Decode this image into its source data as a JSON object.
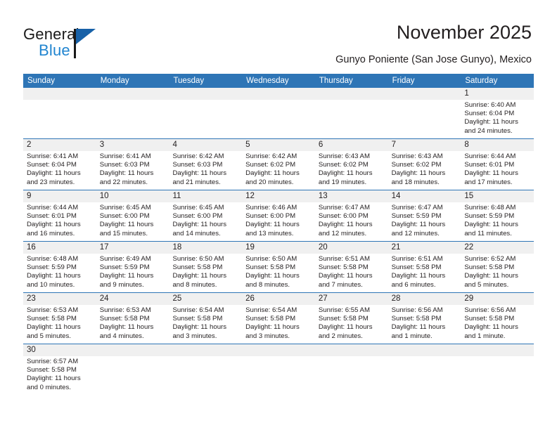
{
  "brand": {
    "name_top": "General",
    "name_bottom": "Blue",
    "accent_color": "#2185d0",
    "triangle_color": "#1761a8"
  },
  "header": {
    "title": "November 2025",
    "subtitle": "Gunyo Poniente (San Jose Gunyo), Mexico",
    "header_bg": "#2e75b6",
    "daynum_band": "#f0f0f0"
  },
  "weekdays": [
    "Sunday",
    "Monday",
    "Tuesday",
    "Wednesday",
    "Thursday",
    "Friday",
    "Saturday"
  ],
  "labels": {
    "sunrise": "Sunrise:",
    "sunset": "Sunset:",
    "daylight": "Daylight:"
  },
  "weeks": [
    [
      {
        "day": "",
        "empty": true
      },
      {
        "day": "",
        "empty": true
      },
      {
        "day": "",
        "empty": true
      },
      {
        "day": "",
        "empty": true
      },
      {
        "day": "",
        "empty": true
      },
      {
        "day": "",
        "empty": true
      },
      {
        "day": "1",
        "sunrise": "Sunrise: 6:40 AM",
        "sunset": "Sunset: 6:04 PM",
        "daylight1": "Daylight: 11 hours",
        "daylight2": "and 24 minutes."
      }
    ],
    [
      {
        "day": "2",
        "sunrise": "Sunrise: 6:41 AM",
        "sunset": "Sunset: 6:04 PM",
        "daylight1": "Daylight: 11 hours",
        "daylight2": "and 23 minutes."
      },
      {
        "day": "3",
        "sunrise": "Sunrise: 6:41 AM",
        "sunset": "Sunset: 6:03 PM",
        "daylight1": "Daylight: 11 hours",
        "daylight2": "and 22 minutes."
      },
      {
        "day": "4",
        "sunrise": "Sunrise: 6:42 AM",
        "sunset": "Sunset: 6:03 PM",
        "daylight1": "Daylight: 11 hours",
        "daylight2": "and 21 minutes."
      },
      {
        "day": "5",
        "sunrise": "Sunrise: 6:42 AM",
        "sunset": "Sunset: 6:02 PM",
        "daylight1": "Daylight: 11 hours",
        "daylight2": "and 20 minutes."
      },
      {
        "day": "6",
        "sunrise": "Sunrise: 6:43 AM",
        "sunset": "Sunset: 6:02 PM",
        "daylight1": "Daylight: 11 hours",
        "daylight2": "and 19 minutes."
      },
      {
        "day": "7",
        "sunrise": "Sunrise: 6:43 AM",
        "sunset": "Sunset: 6:02 PM",
        "daylight1": "Daylight: 11 hours",
        "daylight2": "and 18 minutes."
      },
      {
        "day": "8",
        "sunrise": "Sunrise: 6:44 AM",
        "sunset": "Sunset: 6:01 PM",
        "daylight1": "Daylight: 11 hours",
        "daylight2": "and 17 minutes."
      }
    ],
    [
      {
        "day": "9",
        "sunrise": "Sunrise: 6:44 AM",
        "sunset": "Sunset: 6:01 PM",
        "daylight1": "Daylight: 11 hours",
        "daylight2": "and 16 minutes."
      },
      {
        "day": "10",
        "sunrise": "Sunrise: 6:45 AM",
        "sunset": "Sunset: 6:00 PM",
        "daylight1": "Daylight: 11 hours",
        "daylight2": "and 15 minutes."
      },
      {
        "day": "11",
        "sunrise": "Sunrise: 6:45 AM",
        "sunset": "Sunset: 6:00 PM",
        "daylight1": "Daylight: 11 hours",
        "daylight2": "and 14 minutes."
      },
      {
        "day": "12",
        "sunrise": "Sunrise: 6:46 AM",
        "sunset": "Sunset: 6:00 PM",
        "daylight1": "Daylight: 11 hours",
        "daylight2": "and 13 minutes."
      },
      {
        "day": "13",
        "sunrise": "Sunrise: 6:47 AM",
        "sunset": "Sunset: 6:00 PM",
        "daylight1": "Daylight: 11 hours",
        "daylight2": "and 12 minutes."
      },
      {
        "day": "14",
        "sunrise": "Sunrise: 6:47 AM",
        "sunset": "Sunset: 5:59 PM",
        "daylight1": "Daylight: 11 hours",
        "daylight2": "and 12 minutes."
      },
      {
        "day": "15",
        "sunrise": "Sunrise: 6:48 AM",
        "sunset": "Sunset: 5:59 PM",
        "daylight1": "Daylight: 11 hours",
        "daylight2": "and 11 minutes."
      }
    ],
    [
      {
        "day": "16",
        "sunrise": "Sunrise: 6:48 AM",
        "sunset": "Sunset: 5:59 PM",
        "daylight1": "Daylight: 11 hours",
        "daylight2": "and 10 minutes."
      },
      {
        "day": "17",
        "sunrise": "Sunrise: 6:49 AM",
        "sunset": "Sunset: 5:59 PM",
        "daylight1": "Daylight: 11 hours",
        "daylight2": "and 9 minutes."
      },
      {
        "day": "18",
        "sunrise": "Sunrise: 6:50 AM",
        "sunset": "Sunset: 5:58 PM",
        "daylight1": "Daylight: 11 hours",
        "daylight2": "and 8 minutes."
      },
      {
        "day": "19",
        "sunrise": "Sunrise: 6:50 AM",
        "sunset": "Sunset: 5:58 PM",
        "daylight1": "Daylight: 11 hours",
        "daylight2": "and 8 minutes."
      },
      {
        "day": "20",
        "sunrise": "Sunrise: 6:51 AM",
        "sunset": "Sunset: 5:58 PM",
        "daylight1": "Daylight: 11 hours",
        "daylight2": "and 7 minutes."
      },
      {
        "day": "21",
        "sunrise": "Sunrise: 6:51 AM",
        "sunset": "Sunset: 5:58 PM",
        "daylight1": "Daylight: 11 hours",
        "daylight2": "and 6 minutes."
      },
      {
        "day": "22",
        "sunrise": "Sunrise: 6:52 AM",
        "sunset": "Sunset: 5:58 PM",
        "daylight1": "Daylight: 11 hours",
        "daylight2": "and 5 minutes."
      }
    ],
    [
      {
        "day": "23",
        "sunrise": "Sunrise: 6:53 AM",
        "sunset": "Sunset: 5:58 PM",
        "daylight1": "Daylight: 11 hours",
        "daylight2": "and 5 minutes."
      },
      {
        "day": "24",
        "sunrise": "Sunrise: 6:53 AM",
        "sunset": "Sunset: 5:58 PM",
        "daylight1": "Daylight: 11 hours",
        "daylight2": "and 4 minutes."
      },
      {
        "day": "25",
        "sunrise": "Sunrise: 6:54 AM",
        "sunset": "Sunset: 5:58 PM",
        "daylight1": "Daylight: 11 hours",
        "daylight2": "and 3 minutes."
      },
      {
        "day": "26",
        "sunrise": "Sunrise: 6:54 AM",
        "sunset": "Sunset: 5:58 PM",
        "daylight1": "Daylight: 11 hours",
        "daylight2": "and 3 minutes."
      },
      {
        "day": "27",
        "sunrise": "Sunrise: 6:55 AM",
        "sunset": "Sunset: 5:58 PM",
        "daylight1": "Daylight: 11 hours",
        "daylight2": "and 2 minutes."
      },
      {
        "day": "28",
        "sunrise": "Sunrise: 6:56 AM",
        "sunset": "Sunset: 5:58 PM",
        "daylight1": "Daylight: 11 hours",
        "daylight2": "and 1 minute."
      },
      {
        "day": "29",
        "sunrise": "Sunrise: 6:56 AM",
        "sunset": "Sunset: 5:58 PM",
        "daylight1": "Daylight: 11 hours",
        "daylight2": "and 1 minute."
      }
    ],
    [
      {
        "day": "30",
        "sunrise": "Sunrise: 6:57 AM",
        "sunset": "Sunset: 5:58 PM",
        "daylight1": "Daylight: 11 hours",
        "daylight2": "and 0 minutes."
      },
      {
        "day": "",
        "empty": true
      },
      {
        "day": "",
        "empty": true
      },
      {
        "day": "",
        "empty": true
      },
      {
        "day": "",
        "empty": true
      },
      {
        "day": "",
        "empty": true
      },
      {
        "day": "",
        "empty": true
      }
    ]
  ]
}
